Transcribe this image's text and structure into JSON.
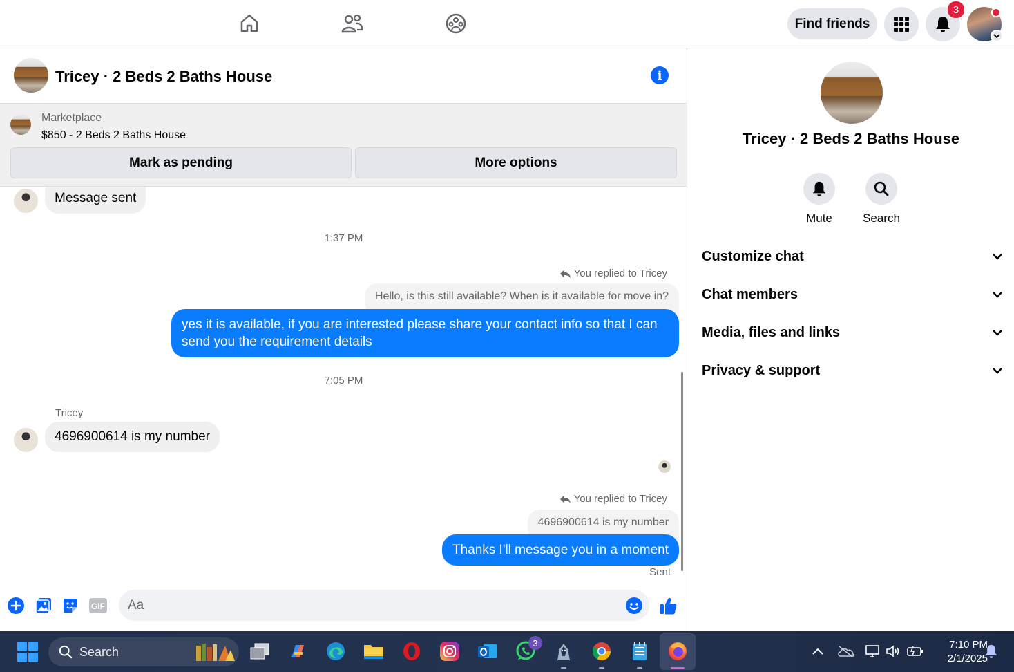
{
  "topnav": {
    "find_friends_label": "Find friends",
    "notifications_count": "3"
  },
  "chat": {
    "title": "Tricey · 2 Beds 2 Baths House",
    "marketplace": {
      "label": "Marketplace",
      "listing": "$850 - 2 Beds 2 Baths House",
      "mark_pending_label": "Mark as pending",
      "more_options_label": "More options"
    },
    "messages": {
      "first_message": "Message sent",
      "time1": "1:37 PM",
      "reply1_label": "You replied to Tricey",
      "reply1_quoted": "Hello, is this still available?  When is it available for move in?",
      "reply1_text": "yes it is available, if you are interested please share your contact info so that I can send you the requirement details",
      "time2": "7:05 PM",
      "sender_name": "Tricey",
      "tricey_message": "4696900614 is my number",
      "reply2_label": "You replied to Tricey",
      "reply2_quoted": "4696900614 is my number",
      "reply2_text": "Thanks I'll message you in a moment",
      "status": "Sent"
    },
    "composer": {
      "placeholder": "Aa"
    }
  },
  "panel": {
    "title": "Tricey · 2 Beds 2 Baths House",
    "mute_label": "Mute",
    "search_label": "Search",
    "sections": [
      {
        "label": "Customize chat"
      },
      {
        "label": "Chat members"
      },
      {
        "label": "Media, files and links"
      },
      {
        "label": "Privacy & support"
      }
    ]
  },
  "taskbar": {
    "search_label": "Search",
    "whatsapp_badge": "3",
    "time": "7:10 PM",
    "date": "2/1/2025"
  },
  "colors": {
    "messenger_blue": "#0a7cff",
    "accent_blue": "#0866ff",
    "badge_red": "#e41e3f"
  }
}
